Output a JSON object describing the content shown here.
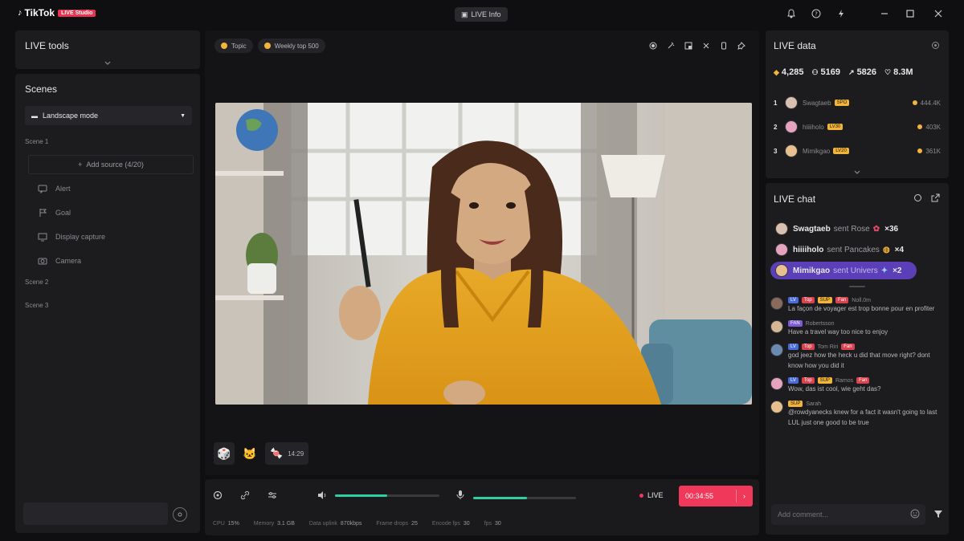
{
  "app": {
    "brand": "TikTok",
    "badge": "LIVE Studio",
    "live_info": "LIVE Info"
  },
  "window_icons": [
    "bell-icon",
    "question-icon",
    "bolt-icon",
    "minimize-icon",
    "maximize-icon",
    "close-icon"
  ],
  "left": {
    "tools_title": "LIVE tools",
    "scenes_title": "Scenes",
    "mode_select": "Landscape mode",
    "scene1": "Scene 1",
    "add_source": "Add source (4/20)",
    "sources": [
      {
        "label": "Alert",
        "icon": "alert-icon"
      },
      {
        "label": "Goal",
        "icon": "goal-icon"
      },
      {
        "label": "Display capture",
        "icon": "monitor-icon"
      },
      {
        "label": "Camera",
        "icon": "camera-icon"
      }
    ],
    "scene2": "Scene 2",
    "scene3": "Scene 3"
  },
  "stage": {
    "topic_label": "Topic",
    "weekly_label": "Weekly top 500",
    "gift_count": "14:29"
  },
  "controls": {
    "live_label": "LIVE",
    "timer": "00:34:55",
    "mic_level": 0.52,
    "audio_level": 0.5,
    "stats": [
      {
        "label": "CPU",
        "value": "15%"
      },
      {
        "label": "Memory",
        "value": "3.1 GB"
      },
      {
        "label": "Data uplink",
        "value": "870kbps"
      },
      {
        "label": "Frame drops",
        "value": "25"
      },
      {
        "label": "Encode fps",
        "value": "30"
      },
      {
        "label": "fps",
        "value": "30"
      }
    ]
  },
  "livedata": {
    "title": "LIVE data",
    "metrics": [
      {
        "icon": "diamond-icon",
        "value": "4,285"
      },
      {
        "icon": "viewers-icon",
        "value": "5169"
      },
      {
        "icon": "share-icon",
        "value": "5826"
      },
      {
        "icon": "heart-icon",
        "value": "8.3M"
      }
    ],
    "ranking": [
      {
        "rank": "1",
        "name": "Swagtaeb",
        "badge": "SPO",
        "coins": "444.4K"
      },
      {
        "rank": "2",
        "name": "hiiiiholo",
        "badge": "LV30",
        "coins": "403K"
      },
      {
        "rank": "3",
        "name": "Mimikgao",
        "badge": "LV20",
        "coins": "361K"
      }
    ]
  },
  "livechat": {
    "title": "LIVE chat",
    "gifts": [
      {
        "user": "Swagtaeb",
        "text": "sent Rose",
        "count": "×36",
        "highlight": false
      },
      {
        "user": "hiiiiholo",
        "text": "sent Pancakes",
        "count": "×4",
        "highlight": false
      },
      {
        "user": "Mimikgao",
        "text": "sent Univers",
        "count": "×2",
        "highlight": true
      }
    ],
    "messages": [
      {
        "tags": [
          "LV",
          "Top",
          "SUP",
          "Fan"
        ],
        "name": "Noll.0m",
        "text": "La façon de voyager est trop bonne pour en profiter"
      },
      {
        "tags": [
          "FAN"
        ],
        "name": "Robertsson",
        "text": "Have a travel way too nice to enjoy"
      },
      {
        "tags": [
          "LV",
          "Top",
          "Fan"
        ],
        "name": "Tom Riri",
        "text": "god jeez how the heck u did that move right? dont know how you did it"
      },
      {
        "tags": [
          "LV",
          "Top",
          "SUP",
          "Fan"
        ],
        "name": "Ramos",
        "text": "Wow, das ist cool, wie geht das?"
      },
      {
        "tags": [
          "SUP"
        ],
        "name": "Sarah",
        "text": "@rowdyanecks knew for a fact it wasn't going to last LUL just one good to be true"
      }
    ],
    "comment_placeholder": "Add comment..."
  }
}
